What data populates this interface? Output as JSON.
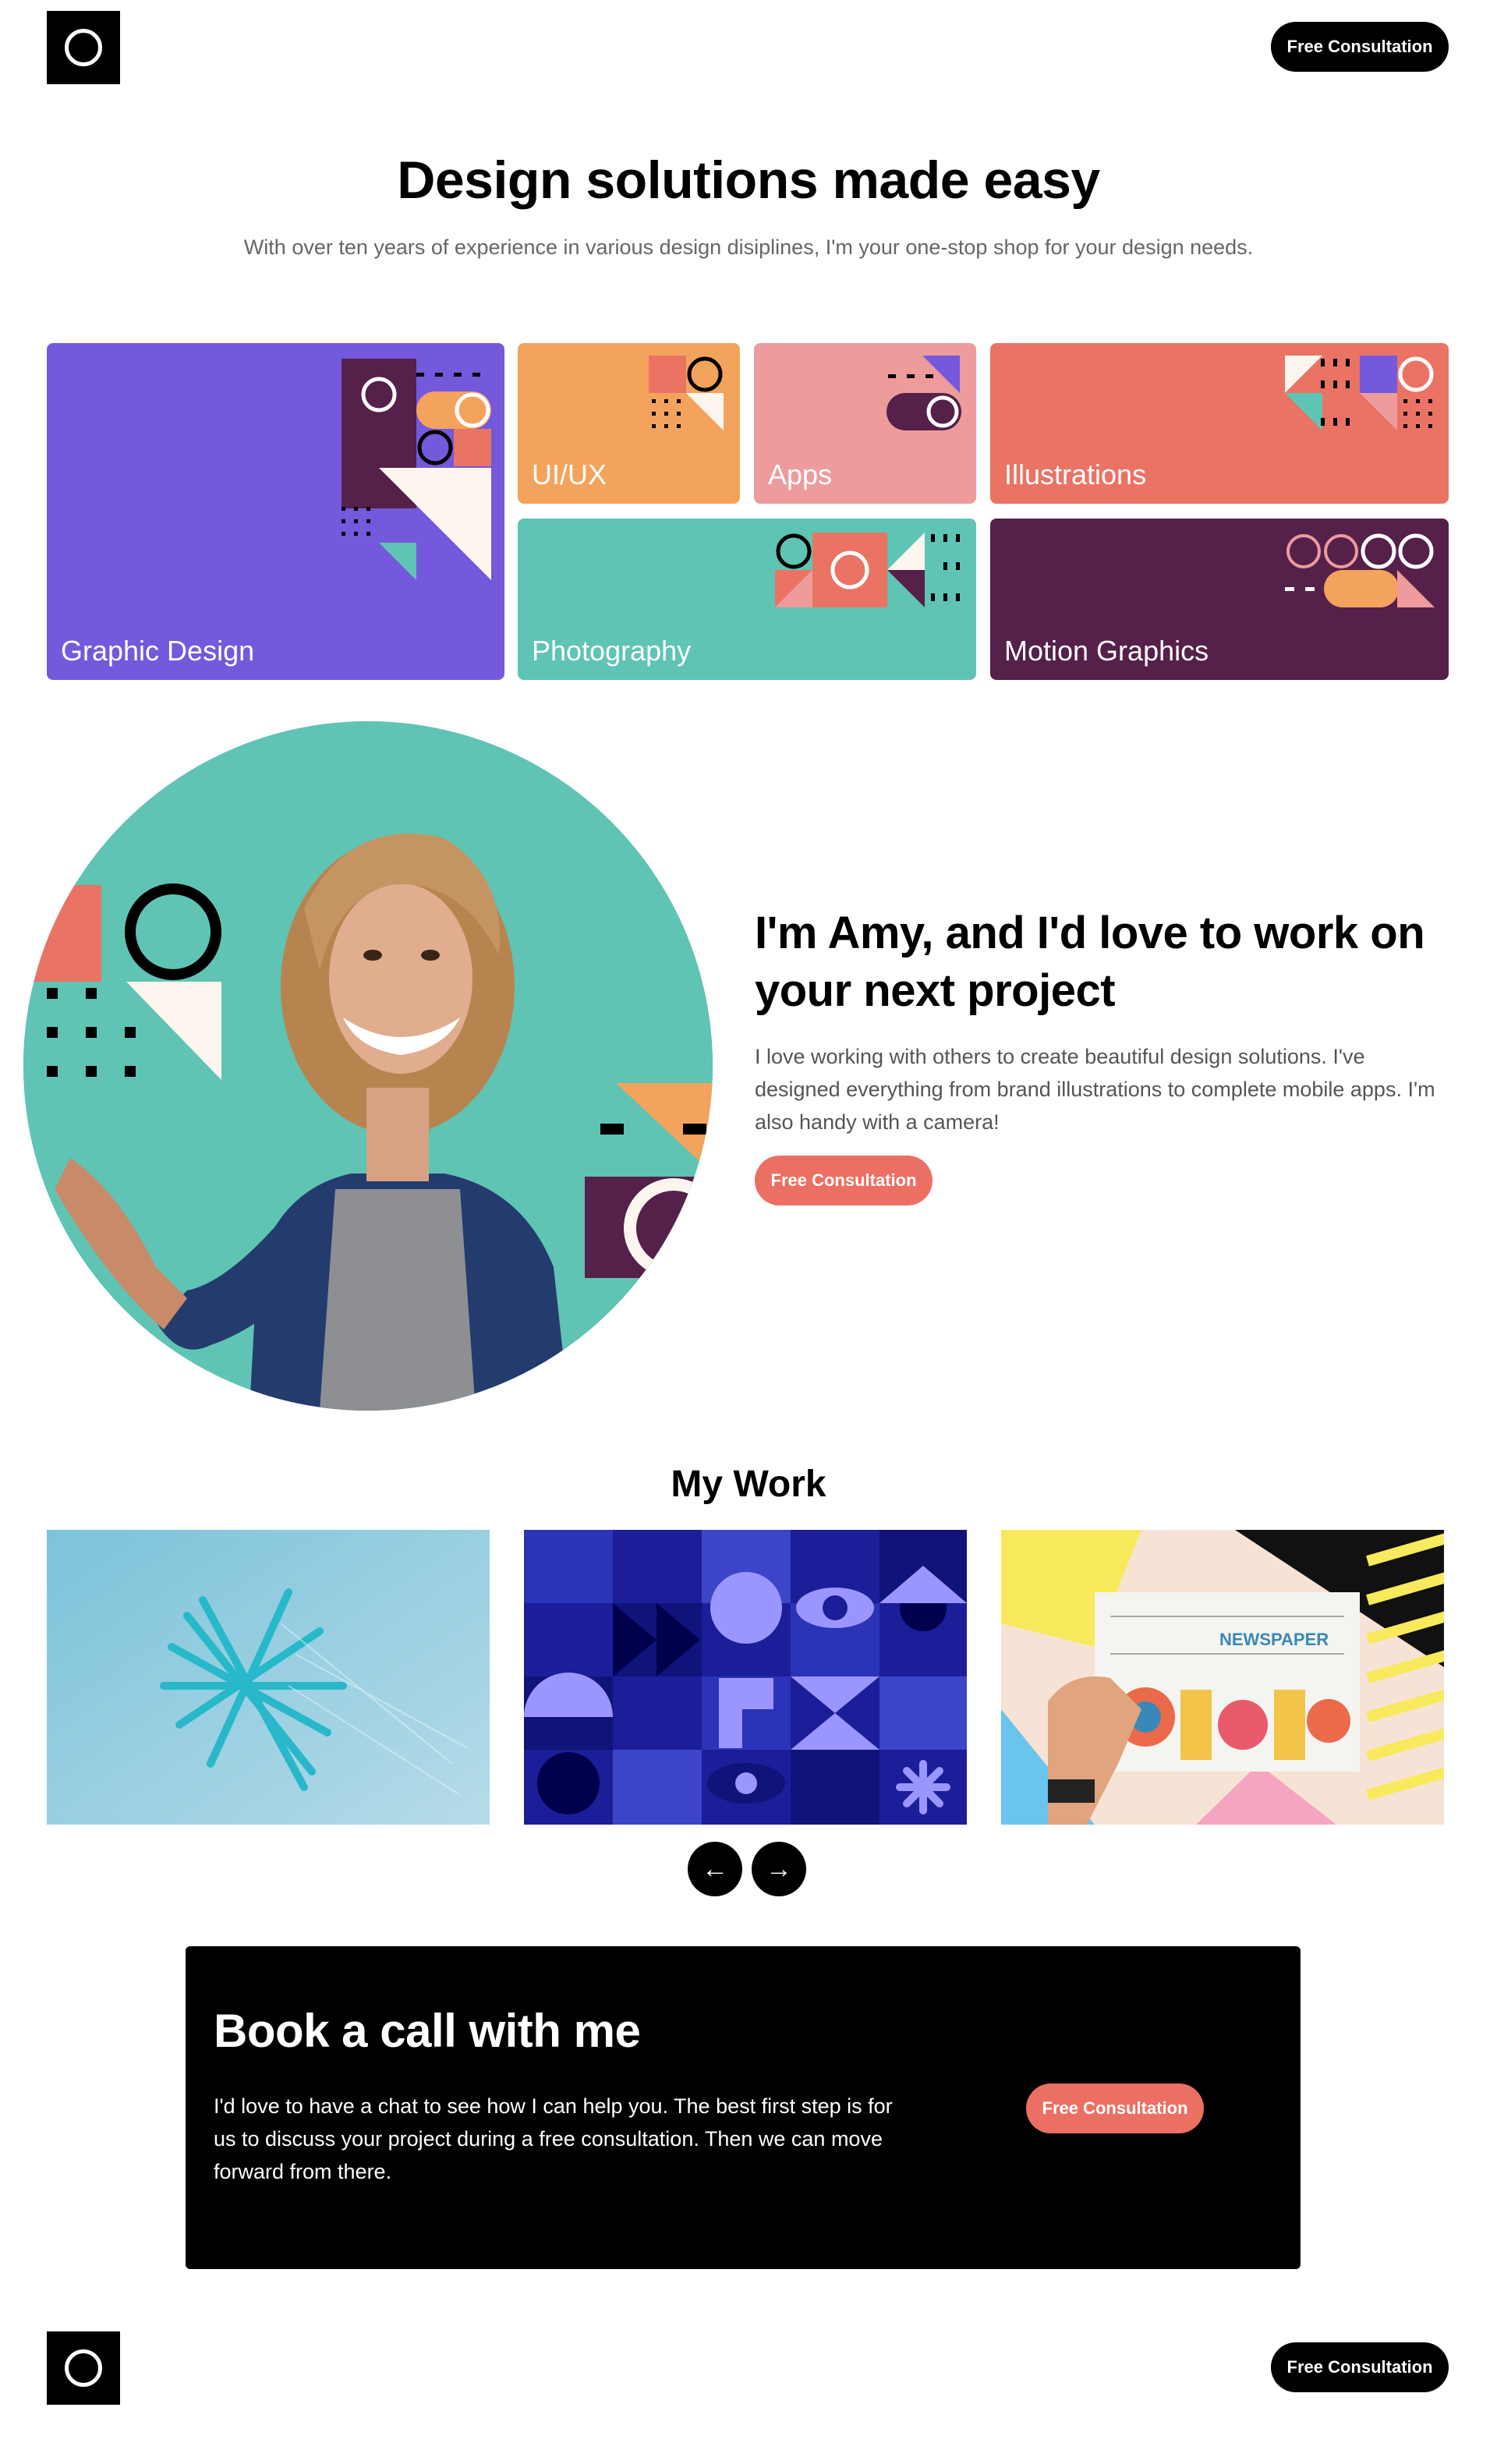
{
  "header": {
    "logo": "logo-ring",
    "cta_label": "Free Consultation"
  },
  "hero": {
    "title": "Design solutions made easy",
    "subtitle": "With over ten years of experience in various design disiplines, I'm your one-stop shop for your design needs."
  },
  "services": [
    {
      "label": "Graphic Design",
      "color": "#7459dc"
    },
    {
      "label": "UI/UX",
      "color": "#f4a35c"
    },
    {
      "label": "Apps",
      "color": "#ee9b9c"
    },
    {
      "label": "Illustrations",
      "color": "#ea7364"
    },
    {
      "label": "Photography",
      "color": "#5fc4b4"
    },
    {
      "label": "Motion Graphics",
      "color": "#55204a"
    }
  ],
  "about": {
    "title": "I'm Amy, and I'd love to work on your next project",
    "text": "I love working with others to create beautiful design solutions. I've designed everything from brand illustrations to complete mobile apps. I'm also handy with a camera!",
    "cta_label": "Free Consultation"
  },
  "work": {
    "title": "My Work",
    "items": [
      "abstract-glass-sculpture",
      "geometric-pattern",
      "newspaper-print"
    ],
    "prev_icon": "arrow-left-icon",
    "next_icon": "arrow-right-icon"
  },
  "cta": {
    "title": "Book a call with me",
    "text": "I'd love to have a chat to see how I can help you. The best first step is for us to discuss your project during a free consultation. Then we can move forward from there.",
    "button_label": "Free Consultation"
  },
  "footer": {
    "logo": "logo-ring",
    "cta_label": "Free Consultation"
  },
  "colors": {
    "coral": "#ec6f63",
    "teal": "#5fc4b4",
    "purple": "#7459dc",
    "plum": "#55204a",
    "orange": "#f4a35c",
    "pink": "#ee9b9c",
    "black": "#000000"
  }
}
